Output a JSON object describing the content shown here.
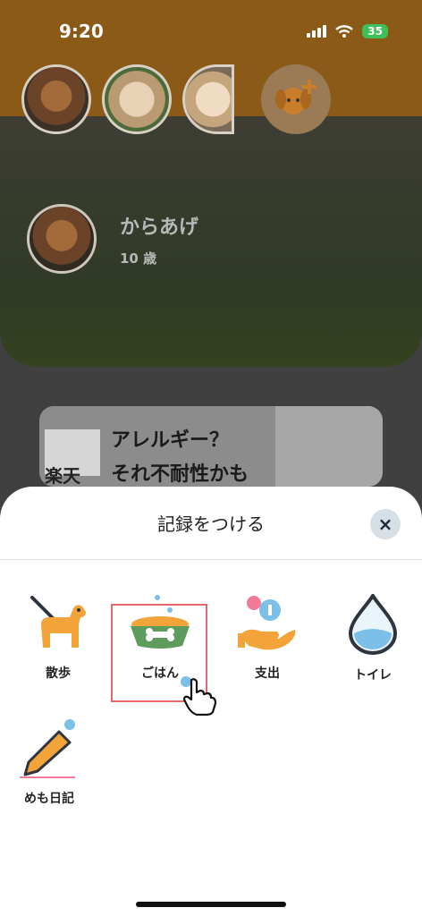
{
  "status": {
    "time": "9:20",
    "battery": "35"
  },
  "pet": {
    "name": "からあげ",
    "age": "10 歳"
  },
  "ad": {
    "brand": "楽天",
    "line1": "アレルギー？",
    "line2": "それ不耐性かも"
  },
  "sheet": {
    "title": "記録をつける",
    "close_icon": "×",
    "items": [
      {
        "label": "散歩",
        "icon": "dog-walk-icon"
      },
      {
        "label": "ごはん",
        "icon": "food-bowl-icon"
      },
      {
        "label": "支出",
        "icon": "expense-coin-icon"
      },
      {
        "label": "トイレ",
        "icon": "water-drop-icon"
      },
      {
        "label": "めも日記",
        "icon": "pencil-memo-icon"
      }
    ]
  },
  "colors": {
    "header": "#8a5a16",
    "accent_orange": "#f2a33a",
    "highlight": "#e46a6a"
  }
}
